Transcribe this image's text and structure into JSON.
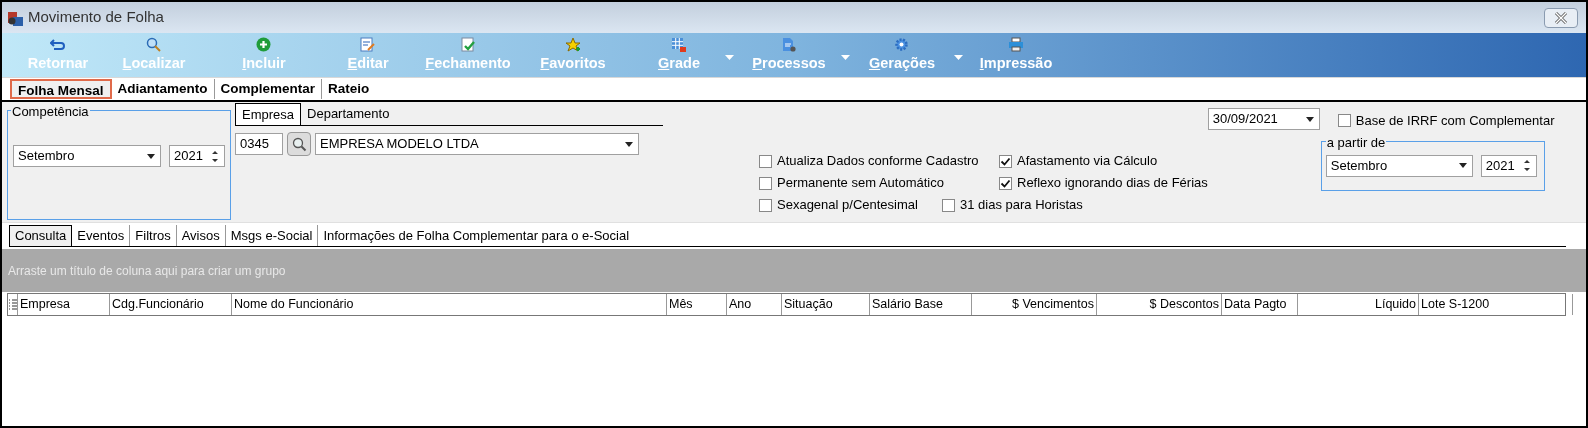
{
  "window": {
    "title": "Movimento de Folha"
  },
  "toolbar": [
    {
      "label": "Retornar",
      "kind": "return",
      "mnemonic": false,
      "has_menu": false
    },
    {
      "label": "Localizar",
      "kind": "search",
      "mnemonic": true,
      "has_menu": false
    },
    {
      "label": "Incluir",
      "kind": "add",
      "mnemonic": true,
      "has_menu": false
    },
    {
      "label": "Editar",
      "kind": "edit",
      "mnemonic": true,
      "has_menu": false
    },
    {
      "label": "Fechamento",
      "kind": "close-doc",
      "mnemonic": true,
      "has_menu": false
    },
    {
      "label": "Favoritos",
      "kind": "star",
      "mnemonic": true,
      "has_menu": false
    },
    {
      "label": "Grade",
      "kind": "grid",
      "mnemonic": true,
      "has_menu": true
    },
    {
      "label": "Processos",
      "kind": "process",
      "mnemonic": true,
      "has_menu": true
    },
    {
      "label": "Gerações",
      "kind": "gear",
      "mnemonic": true,
      "has_menu": true
    },
    {
      "label": "Impressão",
      "kind": "print",
      "mnemonic": true,
      "has_menu": false
    }
  ],
  "main_tabs": [
    {
      "label": "Folha Mensal",
      "selected": true
    },
    {
      "label": "Adiantamento",
      "selected": false
    },
    {
      "label": "Complementar",
      "selected": false
    },
    {
      "label": "Rateio",
      "selected": false
    }
  ],
  "competencia": {
    "title": "Competência",
    "month": "Setembro",
    "year": "2021"
  },
  "company_tabs": [
    {
      "label": "Empresa",
      "selected": true
    },
    {
      "label": "Departamento",
      "selected": false
    }
  ],
  "company": {
    "code": "0345",
    "name": "EMPRESA MODELO LTDA"
  },
  "date": "30/09/2021",
  "options": [
    {
      "label": "Atualiza Dados conforme Cadastro",
      "checked": false
    },
    {
      "label": "Afastamento via Cálculo",
      "checked": true
    },
    {
      "label": "Permanente sem Automático",
      "checked": false
    },
    {
      "label": "Reflexo ignorando dias de Férias",
      "checked": true
    },
    {
      "label": "Sexagenal p/Centesimal",
      "checked": false
    },
    {
      "label": "31 dias para Horistas",
      "checked": false
    }
  ],
  "irrf": {
    "label": "Base de IRRF com Complementar",
    "checked": false,
    "group_title": "a partir de",
    "month": "Setembro",
    "year": "2021"
  },
  "grid_tabs": [
    {
      "label": "Consulta",
      "selected": true
    },
    {
      "label": "Eventos",
      "selected": false
    },
    {
      "label": "Filtros",
      "selected": false
    },
    {
      "label": "Avisos",
      "selected": false
    },
    {
      "label": "Msgs e-Social",
      "selected": false
    },
    {
      "label": "Informações de Folha Complementar para o e-Social",
      "selected": false
    }
  ],
  "group_panel": "Arraste um título de coluna aqui para criar um grupo",
  "table": {
    "columns": [
      "Empresa",
      "Cdg.Funcionário",
      "Nome do Funcionário",
      "Mês",
      "Ano",
      "Situação",
      "Salário Base",
      "$ Vencimentos",
      "$ Descontos",
      "Data Pagto",
      "Líquido",
      "Lote S-1200"
    ]
  }
}
